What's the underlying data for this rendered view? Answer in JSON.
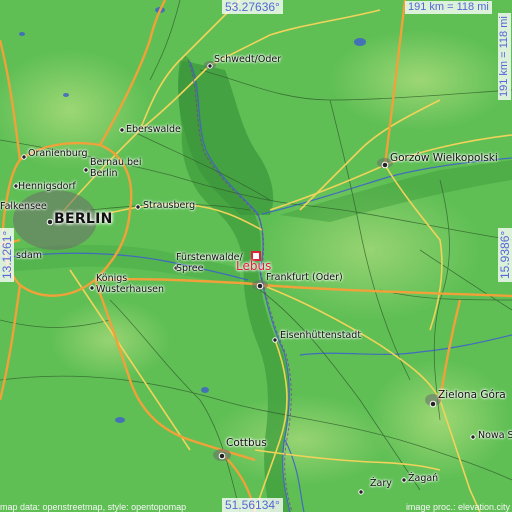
{
  "map": {
    "center_name": "Lebus",
    "places": {
      "schwedt": "Schwedt/Oder",
      "eberswalde": "Eberswalde",
      "oranienburg": "Oranienburg",
      "bernau": "Bernau bei\nBerlin",
      "hennigsdorf": "Hennigsdorf",
      "falkensee": "Falkensee",
      "berlin": "BERLIN",
      "potsdam": "sdam",
      "strausberg": "Strausberg",
      "fuerstenwalde": "Fürstenwalde/\nSpree",
      "koenigs_wusterhausen": "Königs\nWusterhausen",
      "frankfurt": "Frankfurt (Oder)",
      "gorzow": "Gorzów Wielkopolski",
      "eisenhuettenstadt": "Eisenhüttenstadt",
      "zielona_gora": "Zielona Góra",
      "nowa_sol": "Nowa Sól",
      "cottbus": "Cottbus",
      "zary": "Żary",
      "zagan": "Żagań"
    },
    "coordinates": {
      "top": "53.27636°",
      "bottom": "51.56134°",
      "left": "13.1261°",
      "right": "15.9386°"
    },
    "scale": {
      "horizontal": "191 km = 118 mi",
      "vertical": "191 km = 118 mi"
    },
    "credits": {
      "left": "map data: openstreetmap, style: opentopomap",
      "right": "image proc.: elevation.city"
    },
    "colors": {
      "lowland": "#5fbf55",
      "valley": "#3e9a3c",
      "upland": "#8fd06a",
      "motorway": "#f0a13a",
      "primary_road": "#f2d35a",
      "river": "#3f63c8",
      "marker": "#e0213a"
    }
  }
}
